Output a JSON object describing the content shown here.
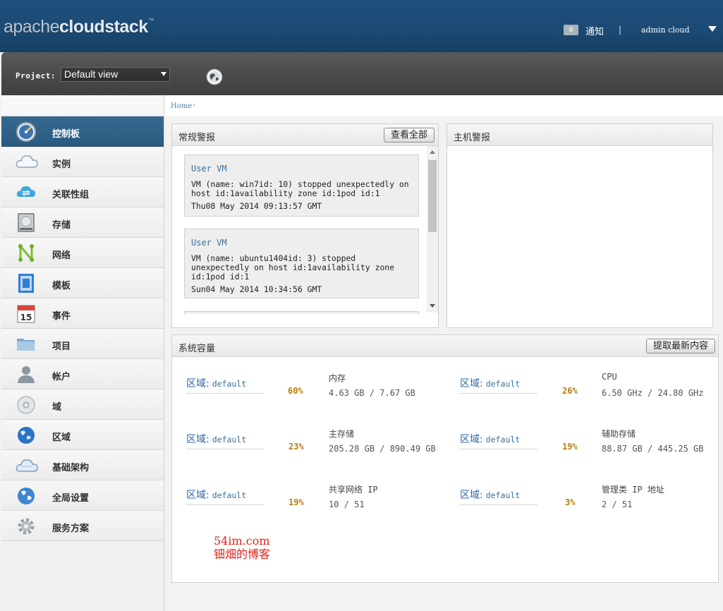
{
  "header": {
    "logo_part1": "apache",
    "logo_part2": "cloudstack",
    "logo_tm": "™",
    "notification_count": "0",
    "notification_label": "通知",
    "separator": "|",
    "user_name": "admin cloud"
  },
  "projectbar": {
    "label": "Project:",
    "selected": "Default view"
  },
  "sidebar": {
    "items": [
      {
        "label": "控制板",
        "icon": "dashboard-gauge-icon",
        "active": true
      },
      {
        "label": "实例",
        "icon": "cloud-icon"
      },
      {
        "label": "关联性组",
        "icon": "cloud-sync-icon"
      },
      {
        "label": "存储",
        "icon": "hard-drive-icon"
      },
      {
        "label": "网络",
        "icon": "network-icon"
      },
      {
        "label": "模板",
        "icon": "template-icon"
      },
      {
        "label": "事件",
        "icon": "calendar-icon"
      },
      {
        "label": "项目",
        "icon": "folder-icon"
      },
      {
        "label": "帐户",
        "icon": "user-icon"
      },
      {
        "label": "域",
        "icon": "disc-icon"
      },
      {
        "label": "区域",
        "icon": "globe-icon"
      },
      {
        "label": "基础架构",
        "icon": "cloud-infrastructure-icon"
      },
      {
        "label": "全局设置",
        "icon": "world-settings-icon"
      },
      {
        "label": "服务方案",
        "icon": "gear-icon"
      }
    ]
  },
  "breadcrumb": {
    "home": "Home",
    "sep": "›"
  },
  "alerts": {
    "title": "常规警报",
    "view_all": "查看全部",
    "items": [
      {
        "title": "User VM",
        "desc": "VM (name: win7id: 10) stopped unexpectedly on host id:1availability zone id:1pod id:1",
        "date": "Thu08 May 2014 09:13:57 GMT"
      },
      {
        "title": "User VM",
        "desc": "VM (name: ubuntu1404id: 3) stopped unexpectedly on host id:1availability zone id:1pod id:1",
        "date": "Sun04 May 2014 10:34:56 GMT"
      }
    ]
  },
  "host_alerts": {
    "title": "主机警报"
  },
  "capacity": {
    "title": "系统容量",
    "refresh": "提取最新内容",
    "zone_key": "区域:",
    "items": [
      {
        "zone": "default",
        "pct": "60%",
        "name": "内存",
        "value": "4.63 GB / 7.67 GB"
      },
      {
        "zone": "default",
        "pct": "26%",
        "name": "CPU",
        "value": "6.50 GHz / 24.80 GHz"
      },
      {
        "zone": "default",
        "pct": "23%",
        "name": "主存储",
        "value": "205.28 GB / 890.49 GB"
      },
      {
        "zone": "default",
        "pct": "19%",
        "name": "辅助存储",
        "value": "88.87 GB / 445.25 GB"
      },
      {
        "zone": "default",
        "pct": "19%",
        "name": "共享网络 IP",
        "value": "10 / 51"
      },
      {
        "zone": "default",
        "pct": "3%",
        "name": "管理类 IP 地址",
        "value": "2 / 51"
      }
    ]
  },
  "watermark": {
    "line1": "54im.com",
    "line2": "钿畑的博客"
  },
  "colors": {
    "header_blue": "#1b4a74",
    "active_nav": "#2f6186",
    "percent": "#b77f0e",
    "link": "#3a6f99",
    "watermark": "#e0241b"
  }
}
